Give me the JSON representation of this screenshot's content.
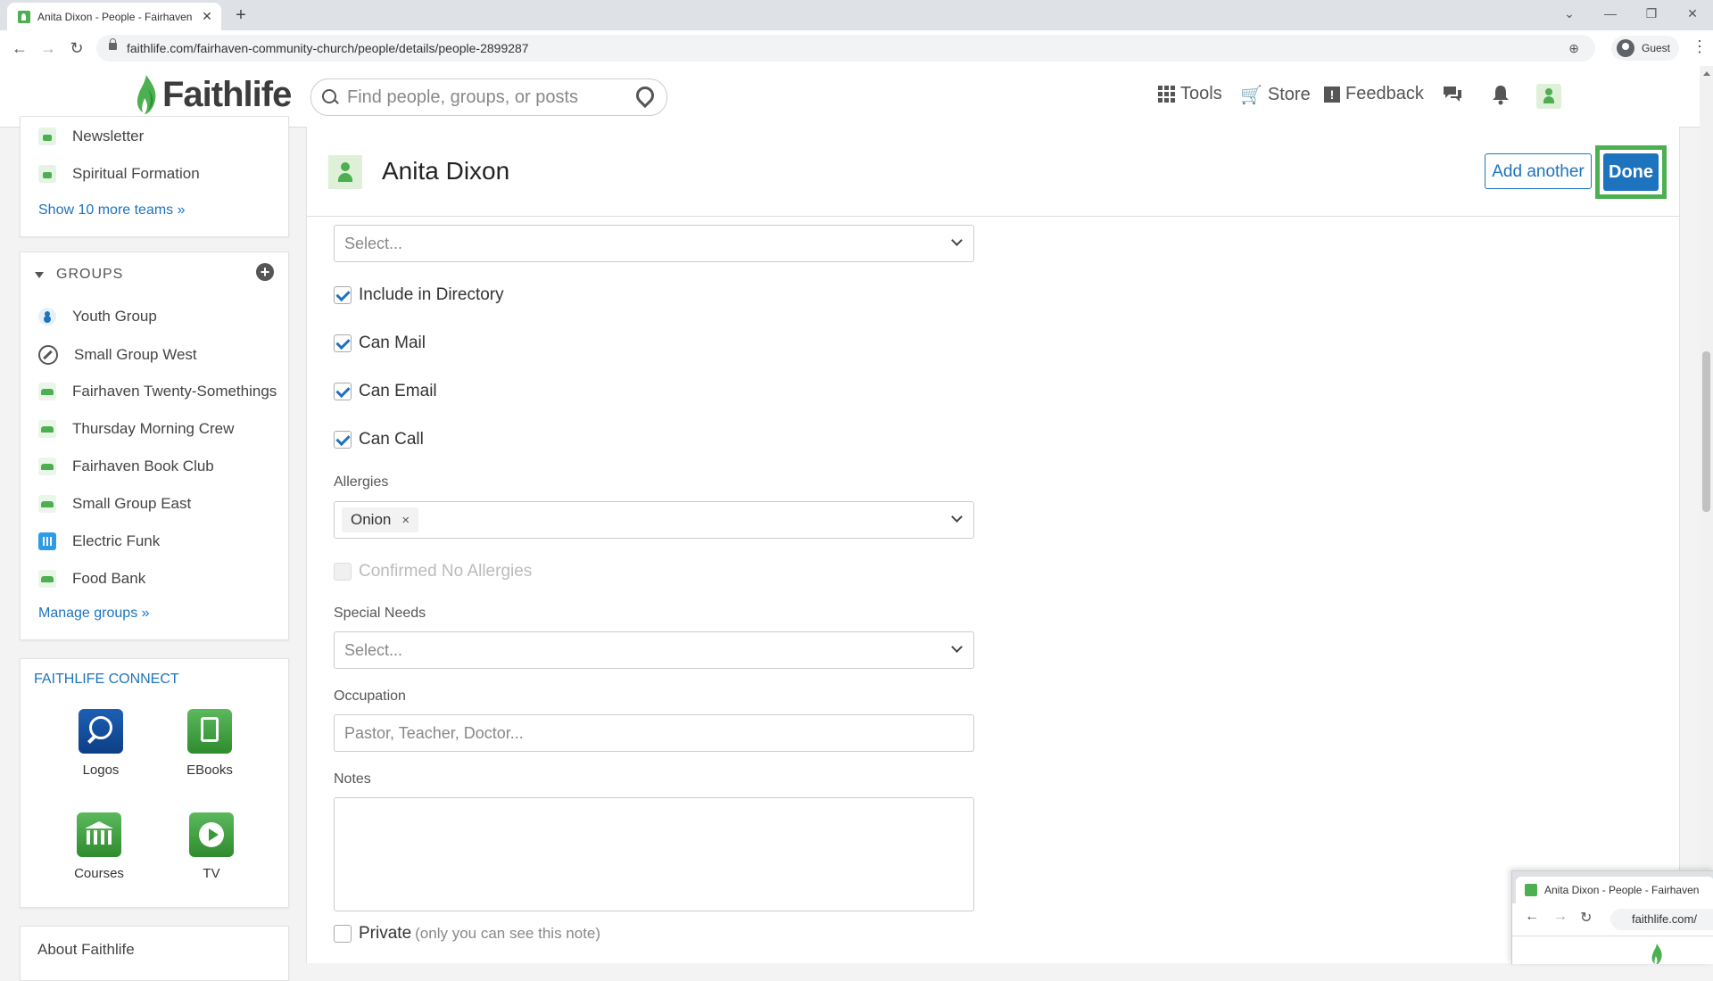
{
  "browser": {
    "tab_title": "Anita Dixon - People - Fairhaven",
    "url": "faithlife.com/fairhaven-community-church/people/details/people-2899287",
    "profile_label": "Guest"
  },
  "header": {
    "logo_text": "Faithlife",
    "search_placeholder": "Find people, groups, or posts",
    "nav": {
      "tools": "Tools",
      "store": "Store",
      "feedback": "Feedback"
    }
  },
  "sidebar": {
    "teams": [
      {
        "label": "Newsletter"
      },
      {
        "label": "Spiritual Formation"
      }
    ],
    "teams_more_link": "Show 10 more teams »",
    "groups_title": "GROUPS",
    "groups": [
      {
        "label": "Youth Group",
        "icon": "person-icon"
      },
      {
        "label": "Small Group West",
        "icon": "compass-icon"
      },
      {
        "label": "Fairhaven Twenty-Somethings",
        "icon": "group-icon"
      },
      {
        "label": "Thursday Morning Crew",
        "icon": "group-icon"
      },
      {
        "label": "Fairhaven Book Club",
        "icon": "group-icon"
      },
      {
        "label": "Small Group East",
        "icon": "group-icon"
      },
      {
        "label": "Electric Funk",
        "icon": "bars-icon"
      },
      {
        "label": "Food Bank",
        "icon": "group-icon"
      }
    ],
    "manage_groups_link": "Manage groups »",
    "connect_title": "FAITHLIFE CONNECT",
    "apps": [
      {
        "label": "Logos"
      },
      {
        "label": "EBooks"
      },
      {
        "label": "Courses"
      },
      {
        "label": "TV"
      }
    ],
    "about_link": "About Faithlife"
  },
  "person": {
    "name": "Anita Dixon",
    "add_another_label": "Add another",
    "done_label": "Done"
  },
  "form": {
    "top_select_placeholder": "Select...",
    "checkboxes": [
      {
        "label": "Include in Directory",
        "checked": true
      },
      {
        "label": "Can Mail",
        "checked": true
      },
      {
        "label": "Can Email",
        "checked": true
      },
      {
        "label": "Can Call",
        "checked": true
      }
    ],
    "allergies_label": "Allergies",
    "allergy_tag": "Onion",
    "allergy_tag_remove": "×",
    "confirmed_no_allergies_label": "Confirmed No Allergies",
    "special_needs_label": "Special Needs",
    "special_needs_placeholder": "Select...",
    "occupation_label": "Occupation",
    "occupation_placeholder": "Pastor, Teacher, Doctor...",
    "notes_label": "Notes",
    "private_label": "Private",
    "private_hint": "(only you can see this note)"
  },
  "overlay_window": {
    "tab_title": "Anita Dixon - People - Fairhaven",
    "url": "faithlife.com/"
  },
  "colors": {
    "accent_blue": "#1e73be",
    "brand_green": "#4caf50"
  }
}
